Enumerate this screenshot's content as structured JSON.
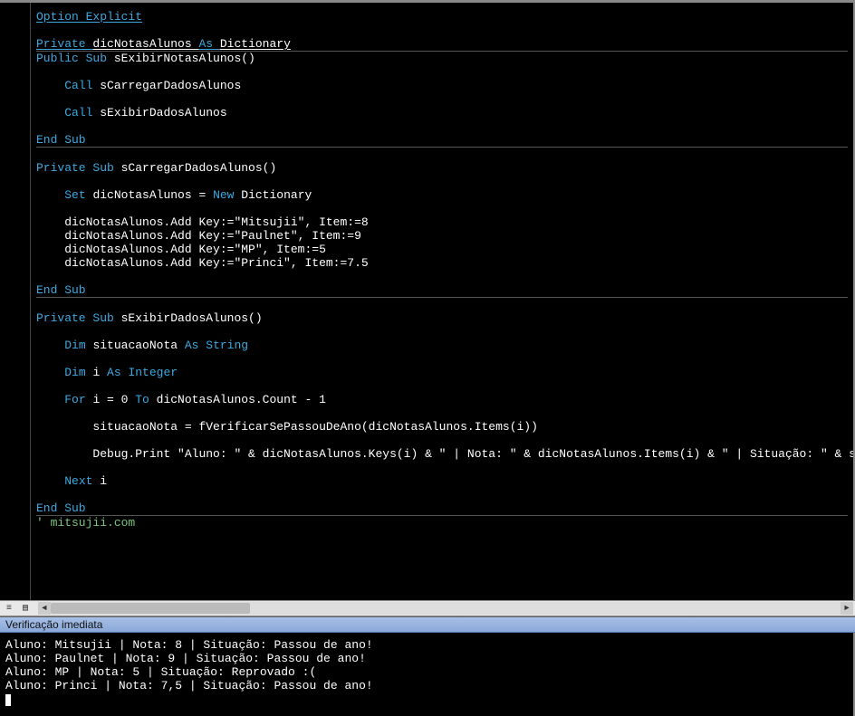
{
  "code": {
    "lines": [
      [
        [
          "kw",
          "Option Explicit"
        ]
      ],
      [],
      [
        [
          "kw",
          "Private "
        ],
        [
          "id",
          "dicNotasAlunos "
        ],
        [
          "kw",
          "As "
        ],
        [
          "id",
          "Dictionary"
        ]
      ],
      "sep",
      [
        [
          "kw",
          "Public Sub "
        ],
        [
          "id",
          "sExibirNotasAlunos()"
        ]
      ],
      [],
      [
        [
          "sp",
          "    "
        ],
        [
          "kw",
          "Call "
        ],
        [
          "id",
          "sCarregarDadosAlunos"
        ]
      ],
      [],
      [
        [
          "sp",
          "    "
        ],
        [
          "kw",
          "Call "
        ],
        [
          "id",
          "sExibirDadosAlunos"
        ]
      ],
      [],
      [
        [
          "kw",
          "End Sub"
        ]
      ],
      "sep",
      [],
      [
        [
          "kw",
          "Private Sub "
        ],
        [
          "id",
          "sCarregarDadosAlunos()"
        ]
      ],
      [],
      [
        [
          "sp",
          "    "
        ],
        [
          "kw",
          "Set "
        ],
        [
          "id",
          "dicNotasAlunos = "
        ],
        [
          "kw",
          "New "
        ],
        [
          "id",
          "Dictionary"
        ]
      ],
      [],
      [
        [
          "sp",
          "    "
        ],
        [
          "id",
          "dicNotasAlunos.Add Key:=\"Mitsujii\", Item:=8"
        ]
      ],
      [
        [
          "sp",
          "    "
        ],
        [
          "id",
          "dicNotasAlunos.Add Key:=\"Paulnet\", Item:=9"
        ]
      ],
      [
        [
          "sp",
          "    "
        ],
        [
          "id",
          "dicNotasAlunos.Add Key:=\"MP\", Item:=5"
        ]
      ],
      [
        [
          "sp",
          "    "
        ],
        [
          "id",
          "dicNotasAlunos.Add Key:=\"Princi\", Item:=7.5"
        ]
      ],
      [],
      [
        [
          "kw",
          "End Sub"
        ]
      ],
      "sep",
      [],
      [
        [
          "kw",
          "Private Sub "
        ],
        [
          "id",
          "sExibirDadosAlunos()"
        ]
      ],
      [],
      [
        [
          "sp",
          "    "
        ],
        [
          "kw",
          "Dim "
        ],
        [
          "id",
          "situacaoNota "
        ],
        [
          "kw",
          "As String"
        ]
      ],
      [],
      [
        [
          "sp",
          "    "
        ],
        [
          "kw",
          "Dim "
        ],
        [
          "id",
          "i "
        ],
        [
          "kw",
          "As Integer"
        ]
      ],
      [],
      [
        [
          "sp",
          "    "
        ],
        [
          "kw",
          "For "
        ],
        [
          "id",
          "i = 0 "
        ],
        [
          "kw",
          "To "
        ],
        [
          "id",
          "dicNotasAlunos.Count - 1"
        ]
      ],
      [],
      [
        [
          "sp",
          "        "
        ],
        [
          "id",
          "situacaoNota = fVerificarSePassouDeAno(dicNotasAlunos.Items(i))"
        ]
      ],
      [],
      [
        [
          "sp",
          "        "
        ],
        [
          "id",
          "Debug.Print \"Aluno: \" & dicNotasAlunos.Keys(i) & \" | Nota: \" & dicNotasAlunos.Items(i) & \" | Situação: \" & situacaoNota"
        ]
      ],
      [],
      [
        [
          "sp",
          "    "
        ],
        [
          "kw",
          "Next "
        ],
        [
          "id",
          "i"
        ]
      ],
      [],
      [
        [
          "kw",
          "End Sub"
        ]
      ],
      "sep",
      [
        [
          "cmt",
          "' mitsujii.com"
        ]
      ]
    ]
  },
  "immediate": {
    "title": "Verificação imediata",
    "output": [
      "Aluno: Mitsujii | Nota: 8 | Situação: Passou de ano!",
      "Aluno: Paulnet | Nota: 9 | Situação: Passou de ano!",
      "Aluno: MP | Nota: 5 | Situação: Reprovado :(",
      "Aluno: Princi | Nota: 7,5 | Situação: Passou de ano!"
    ]
  },
  "toolbar": {
    "btn1_glyph": "≡",
    "btn2_glyph": "▤",
    "arrow_left": "◄",
    "arrow_right": "►"
  }
}
